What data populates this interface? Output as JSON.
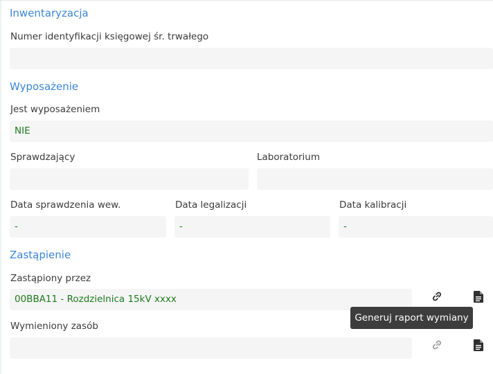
{
  "sections": {
    "inventory": {
      "title": "Inwentaryzacja",
      "account_id_label": "Numer identyfikacji księgowej śr. trwałego",
      "account_id_value": ""
    },
    "equipment": {
      "title": "Wyposażenie",
      "is_equipment_label": "Jest wyposażeniem",
      "is_equipment_value": "NIE",
      "checker_label": "Sprawdzający",
      "checker_value": "",
      "laboratory_label": "Laboratorium",
      "laboratory_value": "",
      "internal_check_date_label": "Data sprawdzenia wew.",
      "internal_check_date_value": "-",
      "legalization_date_label": "Data legalizacji",
      "legalization_date_value": "-",
      "calibration_date_label": "Data kalibracji",
      "calibration_date_value": "-"
    },
    "replacement": {
      "title": "Zastąpienie",
      "replaced_by_label": "Zastąpiony przez",
      "replaced_by_value": "00BBA11 - Rozdzielnica 15kV xxxx",
      "replaced_resource_label": "Wymieniony zasób",
      "replaced_resource_value": "",
      "tooltip": "Generuj raport wymiany",
      "link_icon": "link-icon",
      "report_icon": "document-icon"
    }
  },
  "colors": {
    "section_title": "#3b86d6",
    "field_value": "#1e7a1e",
    "field_background": "#f5f5f5",
    "tooltip_background": "#3d3d3d"
  }
}
